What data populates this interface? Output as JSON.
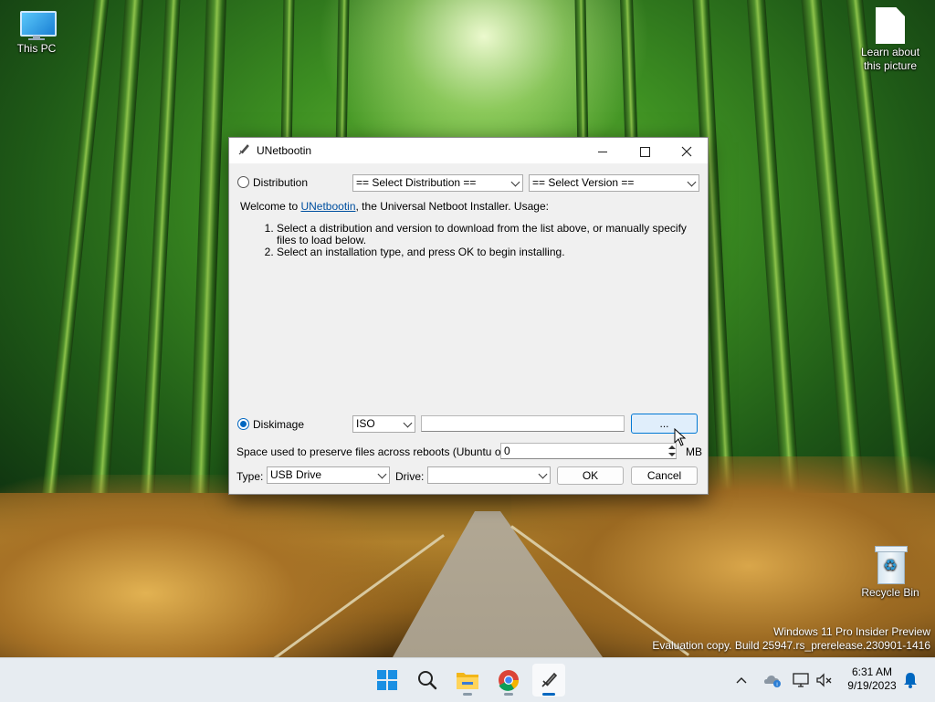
{
  "desktop": {
    "icons": [
      {
        "label": "This PC"
      },
      {
        "label": "Learn about this picture"
      },
      {
        "label": "Recycle Bin"
      }
    ],
    "watermark_line1": "Windows 11 Pro Insider Preview",
    "watermark_line2": "Evaluation copy. Build 25947.rs_prerelease.230901-1416"
  },
  "window": {
    "title": "UNetbootin",
    "distribution_label": "Distribution",
    "distribution_selected": false,
    "select_distribution": "== Select Distribution ==",
    "select_version": "== Select Version ==",
    "welcome_prefix": "Welcome to ",
    "welcome_link": "UNetbootin",
    "welcome_suffix": ", the Universal Netboot Installer. Usage:",
    "steps": [
      "Select a distribution and version to download from the list above, or manually specify files to load below.",
      "Select an installation type, and press OK to begin installing."
    ],
    "diskimage_label": "Diskimage",
    "diskimage_selected": true,
    "diskimage_format": "ISO",
    "diskimage_path": "",
    "browse_label": "...",
    "persist_label": "Space used to preserve files across reboots (Ubuntu only):",
    "persist_value": "0",
    "persist_unit": "MB",
    "type_label": "Type:",
    "type_value": "USB Drive",
    "drive_label": "Drive:",
    "drive_value": "",
    "ok_label": "OK",
    "cancel_label": "Cancel"
  },
  "taskbar": {
    "apps": [
      "start-icon",
      "search-icon",
      "file-explorer-icon",
      "chrome-icon",
      "unetbootin-icon"
    ],
    "time": "6:31 AM",
    "date": "9/19/2023"
  },
  "colors": {
    "accent": "#0067c0",
    "link": "#0050a0",
    "window_bg": "#f0f0f0",
    "taskbar_bg": "#e7ecf1"
  }
}
